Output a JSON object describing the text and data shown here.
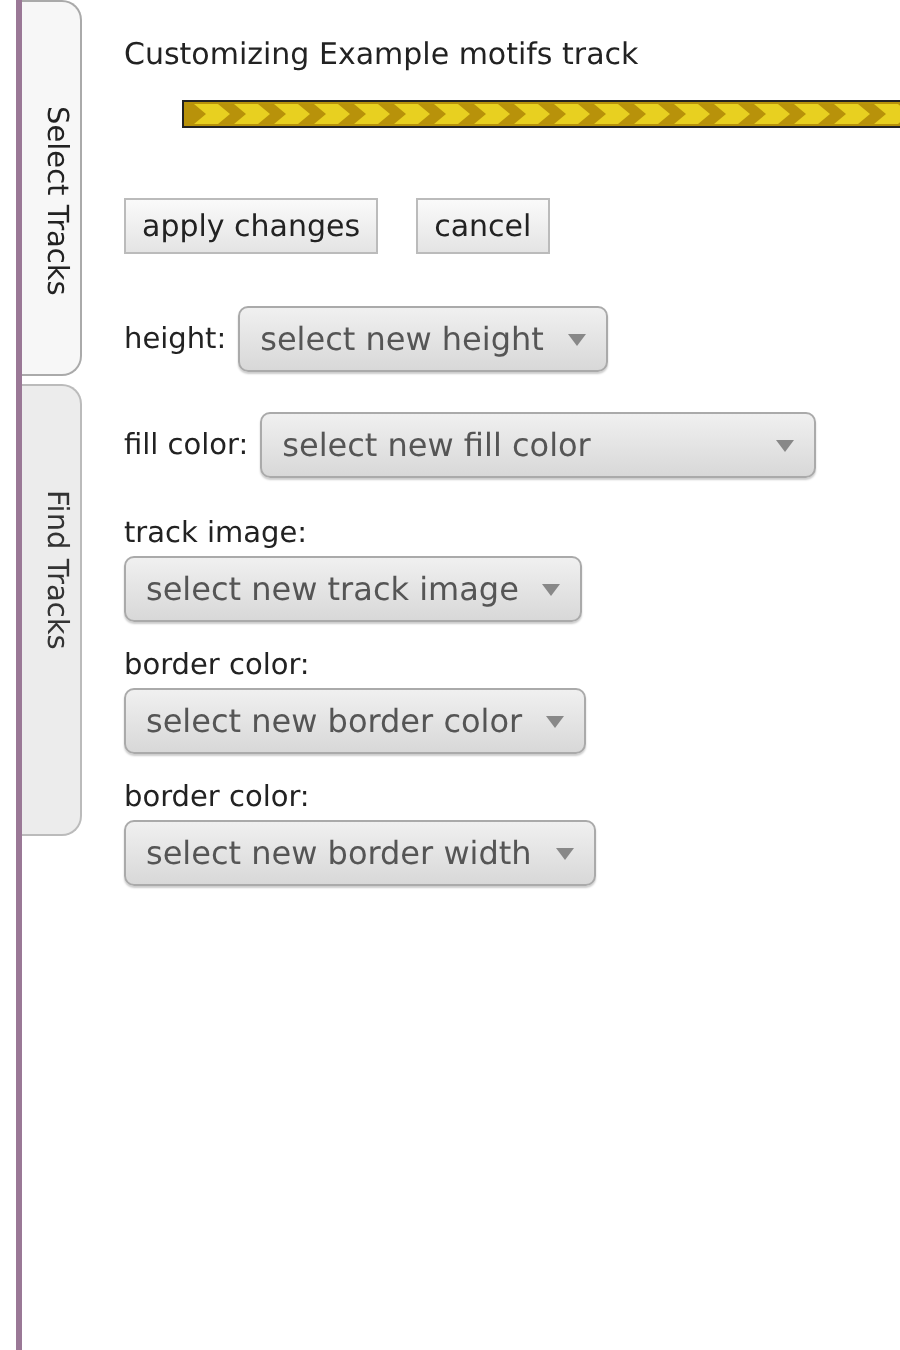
{
  "side_tabs": [
    {
      "label": "Select Tracks",
      "selected": true
    },
    {
      "label": "Find Tracks",
      "selected": false
    }
  ],
  "title": "Customizing Example motifs track",
  "buttons": [
    "apply changes",
    "cancel"
  ],
  "settings": [
    {
      "kind": "inline",
      "label": "height:",
      "placeholder": "select new height"
    },
    {
      "kind": "inline",
      "label": "fill color:",
      "placeholder": "select new fill color"
    },
    {
      "kind": "stacked",
      "label": "track image:",
      "placeholder": "select new track image"
    },
    {
      "kind": "stacked",
      "label": "border color:",
      "placeholder": "select new border color"
    },
    {
      "kind": "stacked",
      "label": "border color:",
      "placeholder": "select new border width"
    }
  ]
}
